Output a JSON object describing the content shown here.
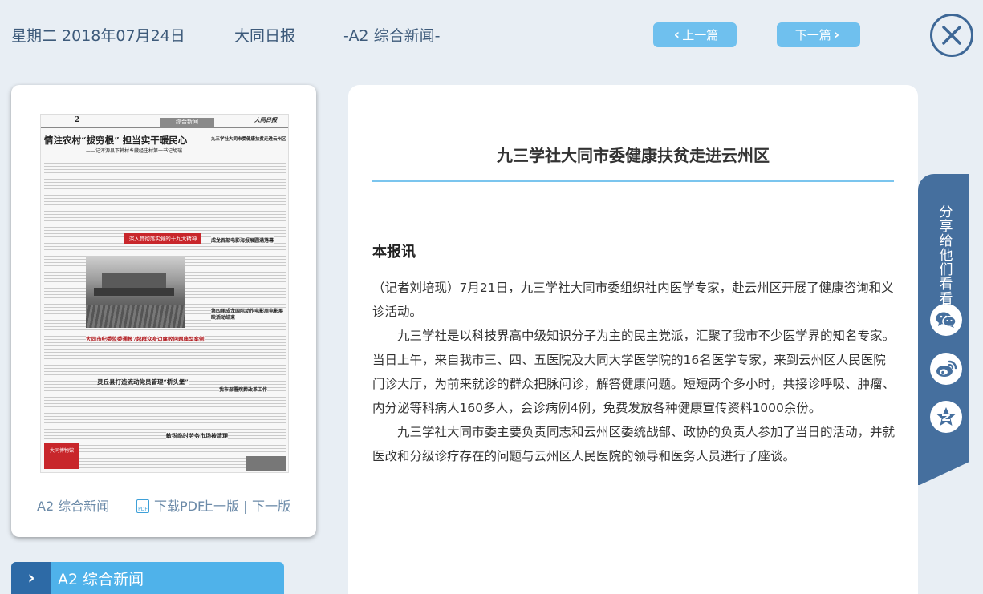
{
  "header": {
    "date": "星期二 2018年07月24日",
    "paper": "大同日报",
    "section": "-A2 综合新闻-",
    "prev_label": "上一篇",
    "next_label": "下一篇"
  },
  "thumbnail": {
    "page_number": "2",
    "page_section": "综合新闻",
    "paper_logo": "大同日报",
    "headlines": [
      "情注农村“拔穷根” 担当实干暖民心",
      "——记浑源县下韩村乡藏经庄村第一书记胡瑞",
      "深入贯彻落实党的十九大精神",
      "大同市纪委监委通报7起群众身边腐败问题典型案例",
      "灵丘县打造流动党员管理“桥头堡”",
      "成龙百部电影海报展圆满落幕",
      "第四届成龙国际动作电影周电影展映活动结束",
      "敏锐临时劳务市场被清理",
      "九三学社大同市委健康扶贫走进云州区",
      "大同博物馆",
      "我市部署殡葬改革工作"
    ],
    "footer_section": "A2 综合新闻",
    "footer_pdf": "下载PDF",
    "footer_prev": "上一版",
    "footer_sep": "|",
    "footer_next": "下一版"
  },
  "section_bar": {
    "label": "A2  综合新闻"
  },
  "article": {
    "title": "九三学社大同市委健康扶贫走进云州区",
    "kicker": "本报讯",
    "paragraphs": [
      "（记者刘培现）7月21日，九三学社大同市委组织社内医学专家，赴云州区开展了健康咨询和义诊活动。",
      "九三学社是以科技界高中级知识分子为主的民主党派，汇聚了我市不少医学界的知名专家。当日上午，来自我市三、四、五医院及大同大学医学院的16名医学专家，来到云州区人民医院门诊大厅，为前来就诊的群众把脉问诊，解答健康问题。短短两个多小时，共接诊呼吸、肿瘤、内分泌等科病人160多人，会诊病例4例，免费发放各种健康宣传资料1000余份。",
      "九三学社大同市委主要负责同志和云州区委统战部、政协的负责人参加了当日的活动，并就医改和分级诊疗存在的问题与云州区人民医院的领导和医务人员进行了座谈。"
    ]
  },
  "share": {
    "label": "分享给他们看看",
    "buttons": [
      "wechat-icon",
      "weibo-icon",
      "qzone-icon"
    ]
  },
  "colors": {
    "accent": "#6fc0ee",
    "dark_blue": "#3d6796",
    "share_tab": "#456f9e",
    "background": "#e8eef4"
  }
}
